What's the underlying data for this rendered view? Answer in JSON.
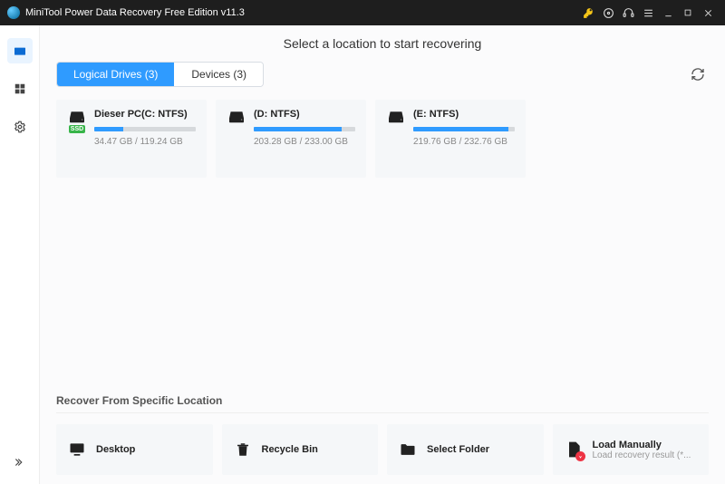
{
  "titlebar": {
    "title": "MiniTool Power Data Recovery Free Edition v11.3"
  },
  "heading": "Select a location to start recovering",
  "tabs": {
    "logical": "Logical Drives (3)",
    "devices": "Devices (3)"
  },
  "drives": [
    {
      "name": "Dieser PC(C: NTFS)",
      "used": "34.47 GB",
      "total": "119.24 GB",
      "pct": 29,
      "ssd": true,
      "ssd_badge": "SSD"
    },
    {
      "name": "(D: NTFS)",
      "used": "203.28 GB",
      "total": "233.00 GB",
      "pct": 87,
      "ssd": false
    },
    {
      "name": "(E: NTFS)",
      "used": "219.76 GB",
      "total": "232.76 GB",
      "pct": 94,
      "ssd": false
    }
  ],
  "section_specific": "Recover From Specific Location",
  "locations": {
    "desktop": "Desktop",
    "recycle": "Recycle Bin",
    "folder": "Select Folder",
    "manual_label": "Load Manually",
    "manual_sub": "Load recovery result (*..."
  }
}
